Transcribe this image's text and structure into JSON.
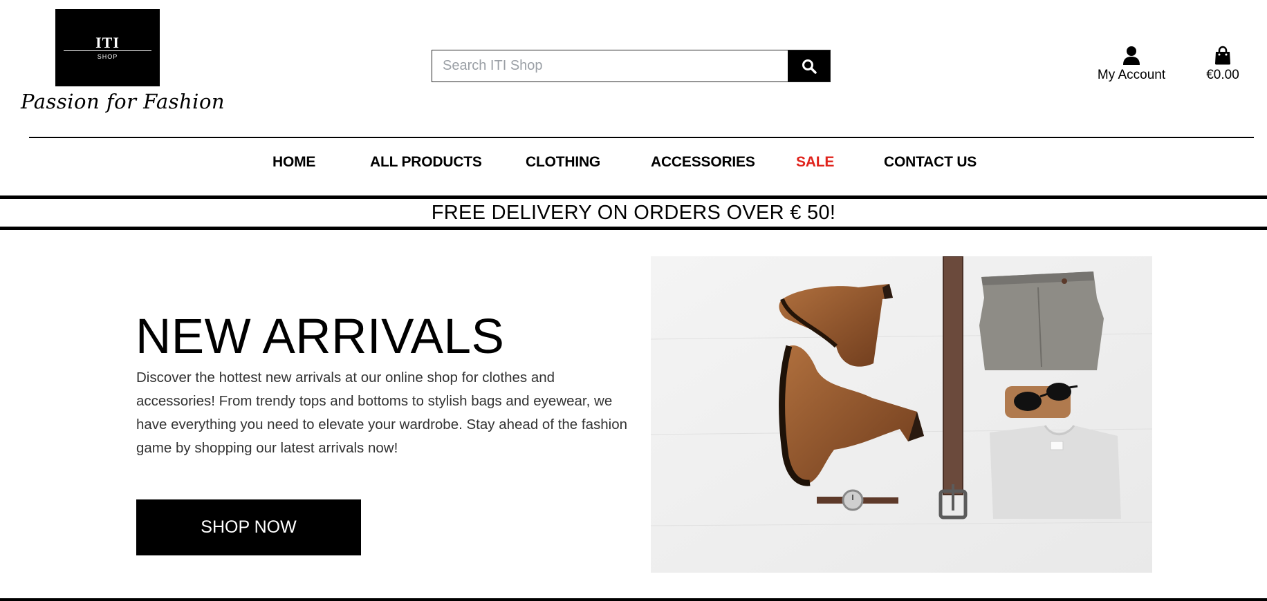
{
  "header": {
    "logo": {
      "name": "ITI",
      "sub": "SHOP"
    },
    "tagline": "Passion for Fashion",
    "search": {
      "placeholder": "Search ITI Shop",
      "value": "",
      "button_icon": "search-icon"
    },
    "account": {
      "label": "My Account",
      "icon": "user-icon"
    },
    "cart": {
      "total": "€0.00",
      "icon": "shopping-bag-icon"
    }
  },
  "nav": {
    "items": [
      {
        "label": "HOME"
      },
      {
        "label": "ALL PRODUCTS"
      },
      {
        "label": "CLOTHING"
      },
      {
        "label": "ACCESSORIES"
      },
      {
        "label": "SALE",
        "color": "#e0231c"
      },
      {
        "label": "CONTACT US"
      }
    ]
  },
  "banner": {
    "text": "FREE DELIVERY ON ORDERS OVER € 50!"
  },
  "hero": {
    "title": "NEW ARRIVALS",
    "description": "Discover the hottest new arrivals at our online shop for clothes and accessories! From trendy tops and bottoms to stylish bags and eyewear, we have everything you need to elevate your wardrobe. Stay ahead of the fashion game by shopping our latest arrivals now!",
    "button_label": "SHOP NOW"
  }
}
